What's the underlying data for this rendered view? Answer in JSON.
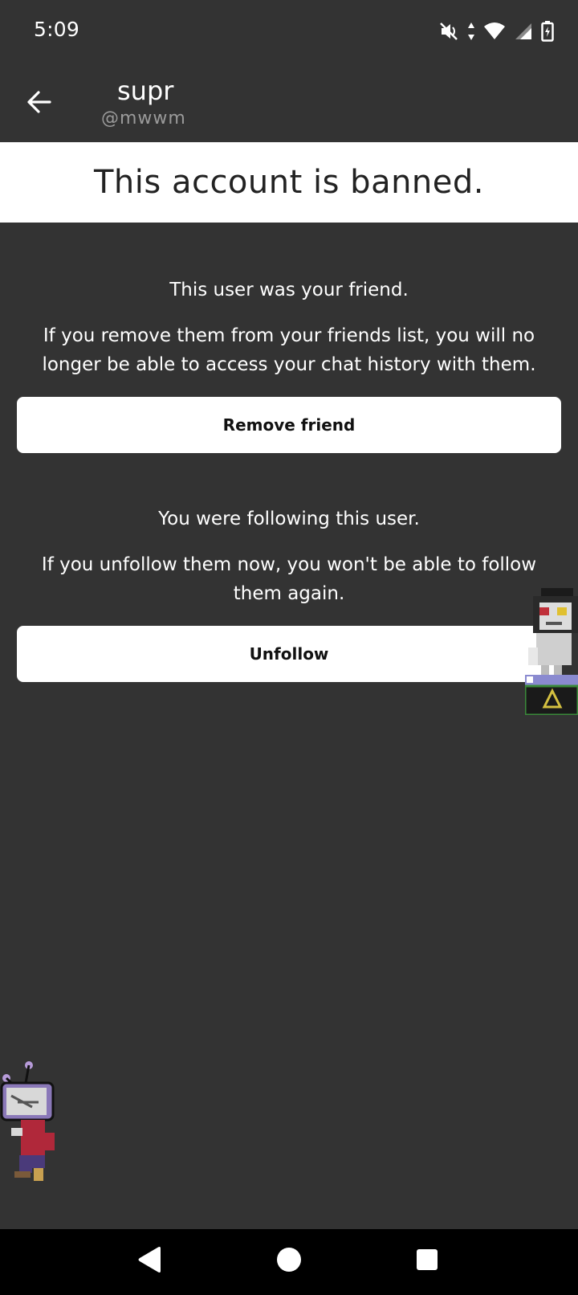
{
  "status_bar": {
    "time": "5:09",
    "icons": [
      "mute-icon",
      "data-arrows-icon",
      "wifi-icon",
      "signal-icon",
      "battery-charging-icon"
    ]
  },
  "header": {
    "name": "supr",
    "handle": "@mwwm"
  },
  "banner": {
    "text": "This account is banned."
  },
  "friend_section": {
    "title": "This user was your friend.",
    "description": "If you remove them from your friends list, you will no longer be able to access your chat history with them.",
    "button_label": "Remove friend"
  },
  "follow_section": {
    "title": "You were following this user.",
    "description": "If you unfollow them now, you won't be able to follow them again.",
    "button_label": "Unfollow"
  },
  "colors": {
    "background": "#333333",
    "banner": "#ffffff",
    "button": "#ffffff",
    "nav_bar": "#000000"
  },
  "nav": {
    "icons": [
      "back-triangle-icon",
      "home-circle-icon",
      "recents-square-icon"
    ]
  }
}
